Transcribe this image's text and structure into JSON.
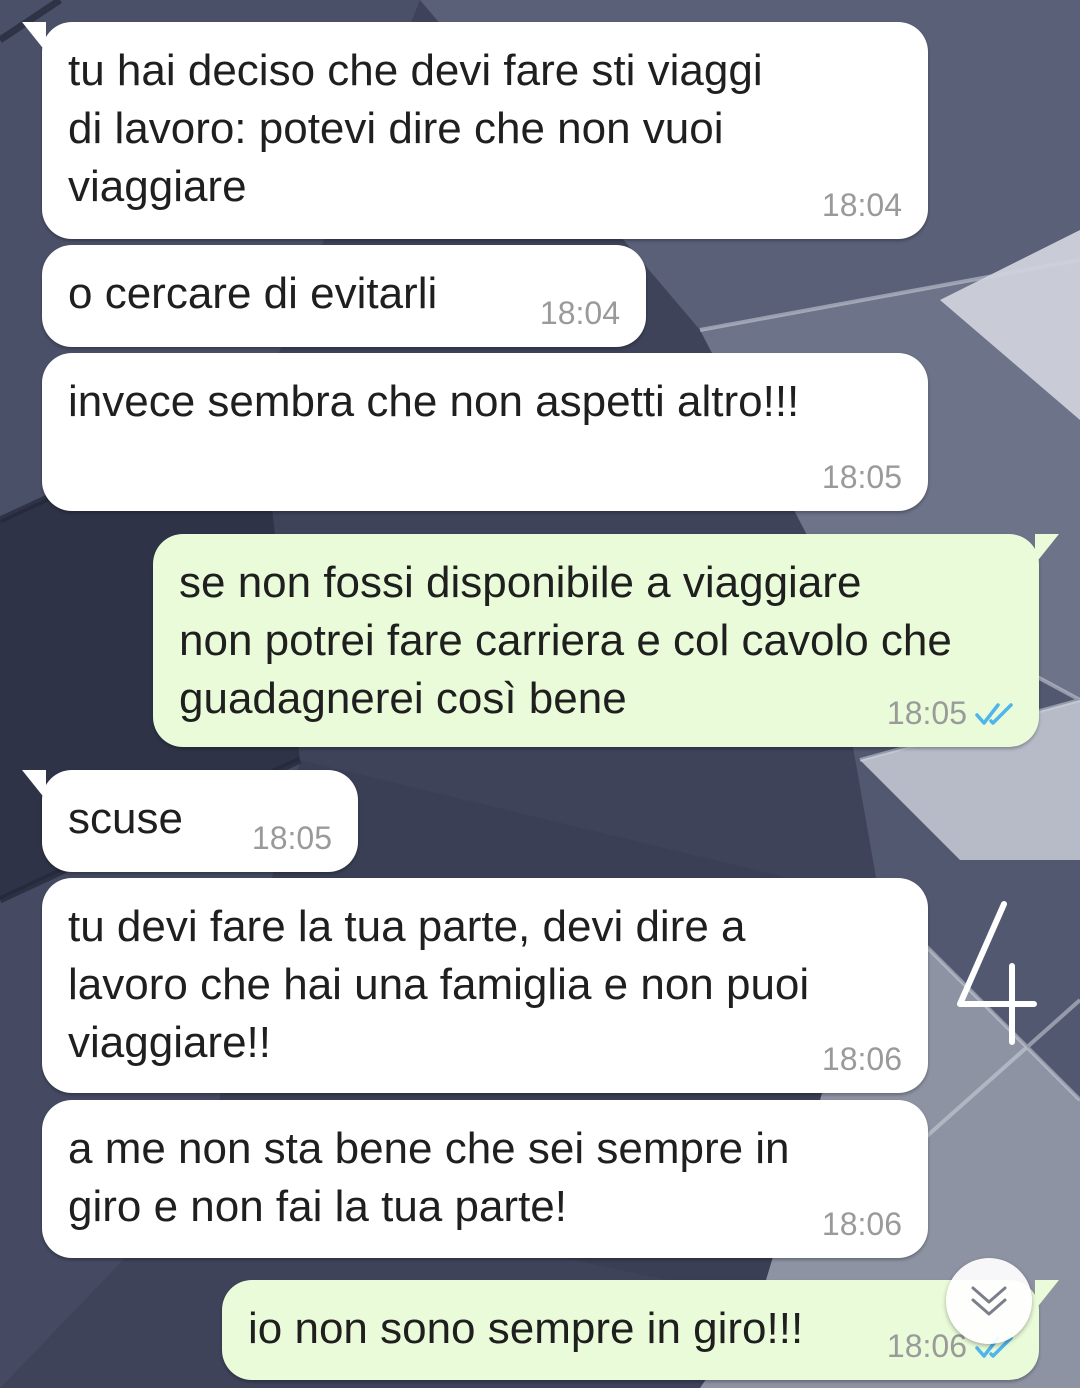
{
  "chat": {
    "messages": [
      {
        "direction": "incoming",
        "text": "tu hai deciso che devi fare sti viaggi\ndi lavoro: potevi dire che non vuoi\nviaggiare",
        "time": "18:04"
      },
      {
        "direction": "incoming",
        "text": "o cercare di evitarli",
        "time": "18:04"
      },
      {
        "direction": "incoming",
        "text": "invece sembra che non aspetti altro!!!",
        "time": "18:05"
      },
      {
        "direction": "outgoing",
        "text": "se non fossi disponibile a viaggiare\nnon potrei fare carriera e col cavolo che\nguadagnerei così bene",
        "time": "18:05",
        "status": "read"
      },
      {
        "direction": "incoming",
        "text": "scuse",
        "time": "18:05"
      },
      {
        "direction": "incoming",
        "text": "tu devi fare la tua parte, devi dire a\nlavoro che hai una famiglia e non puoi\nviaggiare!!",
        "time": "18:06"
      },
      {
        "direction": "incoming",
        "text": "a me non sta bene che sei sempre in\ngiro e non fai la tua parte!",
        "time": "18:06"
      },
      {
        "direction": "outgoing",
        "text": "io non sono sempre in giro!!!",
        "time": "18:06",
        "status": "read"
      }
    ]
  },
  "colors": {
    "incoming_bubble": "#ffffff",
    "outgoing_bubble": "#e9fbd8",
    "read_ticks": "#4fb6ec",
    "timestamp": "#9a9a9a"
  },
  "icons": {
    "read_receipt": "double-check-icon",
    "scroll_down": "double-chevron-down-icon"
  }
}
